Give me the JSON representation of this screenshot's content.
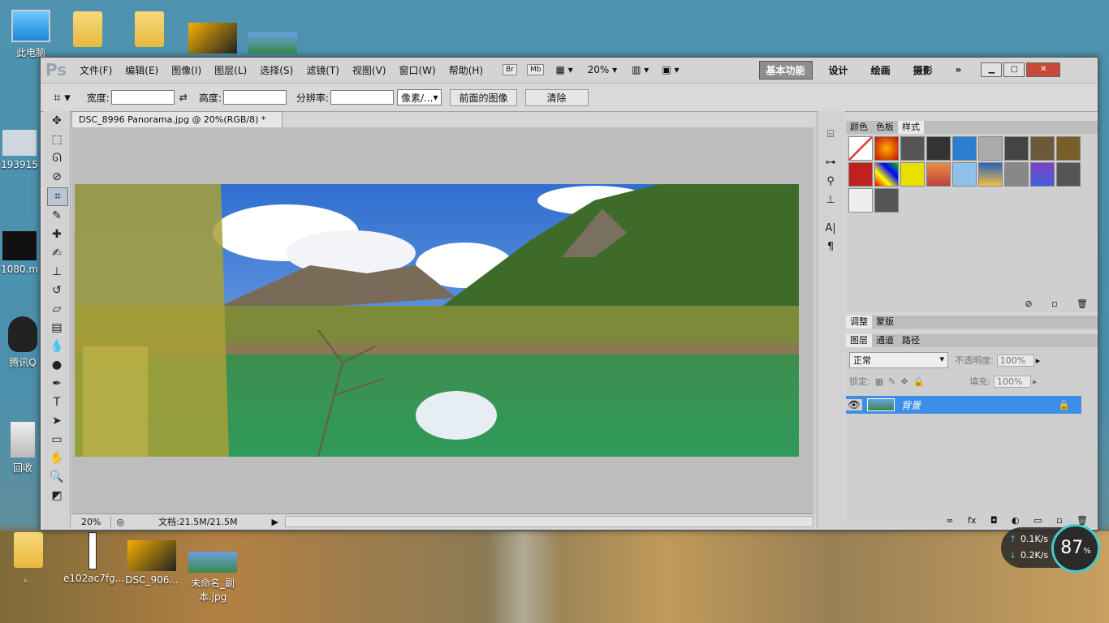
{
  "desktop": {
    "left_icons": [
      {
        "label": "此电脑"
      },
      {
        "label": "193915"
      },
      {
        "label": "1080.m"
      },
      {
        "label": "腾讯Q"
      },
      {
        "label": "回收"
      }
    ],
    "top_icons": [
      {
        "label": ""
      },
      {
        "label": ""
      },
      {
        "label": ""
      },
      {
        "label": ""
      }
    ],
    "bottom_icons": [
      {
        "label": "。"
      },
      {
        "label": "e102ac7fg..."
      },
      {
        "label": "DSC_906..."
      },
      {
        "label": "未命名_副本.jpg"
      }
    ]
  },
  "app": {
    "logo": "Ps",
    "menus": [
      "文件(F)",
      "编辑(E)",
      "图像(I)",
      "图层(L)",
      "选择(S)",
      "滤镜(T)",
      "视图(V)",
      "窗口(W)",
      "帮助(H)"
    ],
    "bridge_btn": "Br",
    "mini_btn": "Mb",
    "zoom": "20%",
    "workspaces": [
      "基本功能",
      "设计",
      "绘画",
      "摄影"
    ],
    "more": "»",
    "options": {
      "width_label": "宽度:",
      "height_label": "高度:",
      "resolution_label": "分辨率:",
      "unit_select": "像素/...",
      "front_image_btn": "前面的图像",
      "clear_btn": "清除"
    },
    "document": {
      "tab_title": "DSC_8996 Panorama.jpg @ 20%(RGB/8) *",
      "status_zoom": "20%",
      "status_doc": "文档:21.5M/21.5M"
    },
    "panels": {
      "color_tabs": [
        "颜色",
        "色板",
        "样式"
      ],
      "adjust_tabs": [
        "调整",
        "蒙版"
      ],
      "layer_tabs": [
        "图层",
        "通道",
        "路径"
      ],
      "blend_mode": "正常",
      "opacity_label": "不透明度:",
      "opacity_value": "100%",
      "lock_label": "锁定:",
      "fill_label": "填充:",
      "fill_value": "100%",
      "layer_name": "背景"
    }
  },
  "system": {
    "net_up": "0.1K/s",
    "net_down": "0.2K/s",
    "gauge": "87",
    "gauge_unit": "%"
  }
}
